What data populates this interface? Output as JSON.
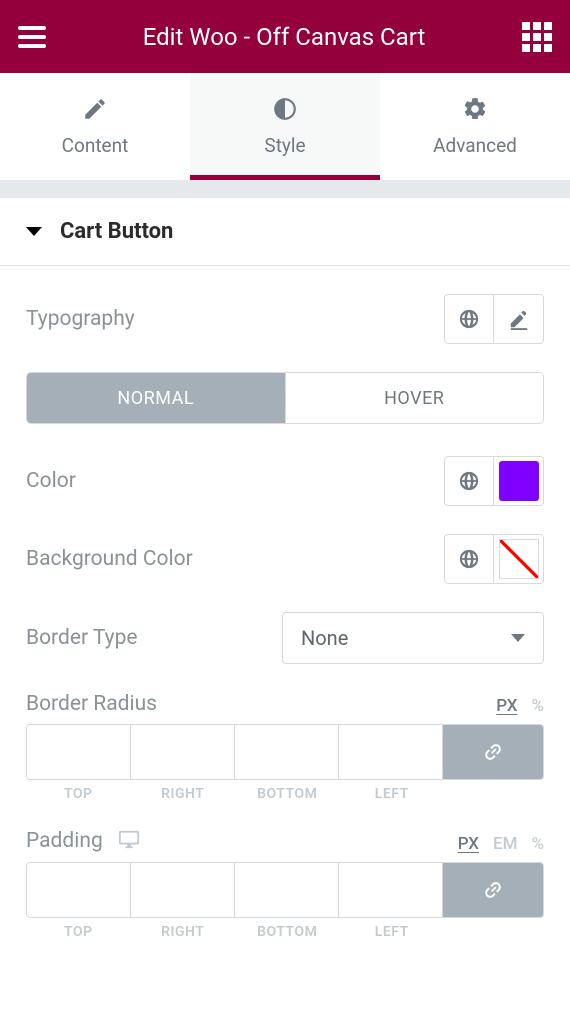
{
  "header": {
    "title": "Edit Woo - Off Canvas Cart"
  },
  "tabs": {
    "content": "Content",
    "style": "Style",
    "advanced": "Advanced"
  },
  "section": {
    "title": "Cart Button"
  },
  "controls": {
    "typography_label": "Typography",
    "state_normal": "NORMAL",
    "state_hover": "HOVER",
    "color_label": "Color",
    "color_value": "#8000FF",
    "bg_color_label": "Background Color",
    "border_type_label": "Border Type",
    "border_type_value": "None",
    "border_radius_label": "Border Radius",
    "padding_label": "Padding",
    "units": {
      "px": "PX",
      "em": "EM",
      "percent": "%"
    },
    "dims": {
      "top": "TOP",
      "right": "RIGHT",
      "bottom": "BOTTOM",
      "left": "LEFT"
    }
  }
}
